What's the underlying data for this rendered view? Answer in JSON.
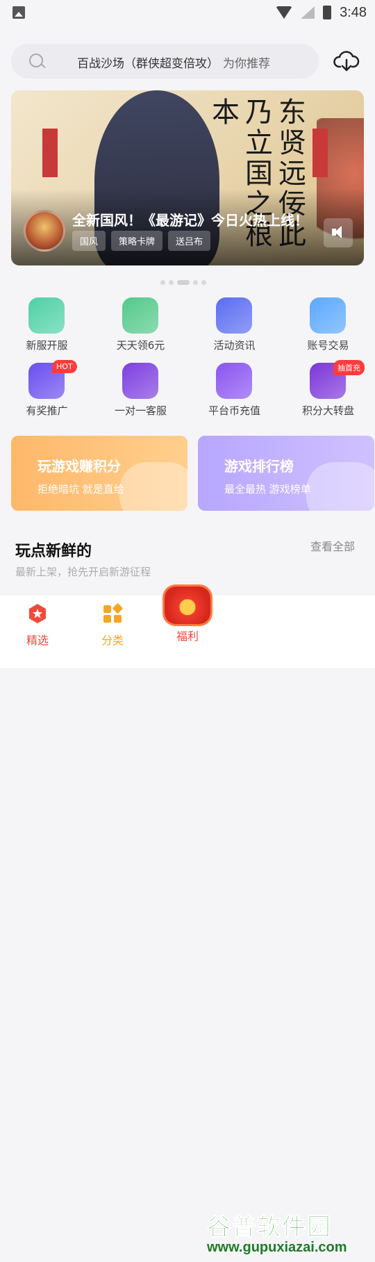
{
  "status": {
    "time": "3:48"
  },
  "search": {
    "query": "百战沙场（群侠超变倍攻）",
    "hint": "为你推荐"
  },
  "banner": {
    "title": "全新国风！《最游记》今日火热上线！",
    "tags": [
      "国风",
      "策略卡牌",
      "送吕布"
    ],
    "calligraphy": "东贤远佞此乃立国之根本",
    "pagination": {
      "count": 5,
      "active_index": 2
    }
  },
  "grid": [
    {
      "label": "新服开服",
      "icon": "new-server-icon",
      "color": "#4fd1a5"
    },
    {
      "label": "天天领6元",
      "icon": "daily-cash-icon",
      "color": "#53c98a"
    },
    {
      "label": "活动资讯",
      "icon": "activity-news-icon",
      "color": "#5b6cf2"
    },
    {
      "label": "账号交易",
      "icon": "account-trade-icon",
      "color": "#5ba8ff"
    },
    {
      "label": "有奖推广",
      "icon": "promotion-icon",
      "color": "#6a4df0",
      "badge": "HOT"
    },
    {
      "label": "一对一客服",
      "icon": "customer-service-icon",
      "color": "#7d3fe0"
    },
    {
      "label": "平台币充值",
      "icon": "coin-recharge-icon",
      "color": "#8a54f0"
    },
    {
      "label": "积分大转盘",
      "icon": "lucky-wheel-icon",
      "color": "#7c35d9",
      "badge": "抽首充"
    }
  ],
  "promos": [
    {
      "title": "玩游戏赚积分",
      "subtitle": "拒绝暗坑 就是直给",
      "color_from": "#ffb86a",
      "color_to": "#ffcf8e"
    },
    {
      "title": "游戏排行榜",
      "subtitle": "最全最热 游戏榜单",
      "color_from": "#b7a7ff",
      "color_to": "#cfc1ff"
    }
  ],
  "section": {
    "title": "玩点新鲜的",
    "more": "查看全部",
    "subtitle": "最新上架，抢先开启新游征程"
  },
  "tabs": [
    {
      "label": "精选",
      "icon": "featured-icon",
      "color": "#f04a3b"
    },
    {
      "label": "分类",
      "icon": "category-icon",
      "color": "#f5a623"
    },
    {
      "label": "福利",
      "icon": "welfare-icon",
      "color": "#f04a3b"
    }
  ],
  "watermark": {
    "cn": "谷普软件园",
    "url": "www.gupuxiazai.com"
  },
  "colors": {
    "accent": "#f04a3b",
    "background": "#f5f5f7"
  }
}
